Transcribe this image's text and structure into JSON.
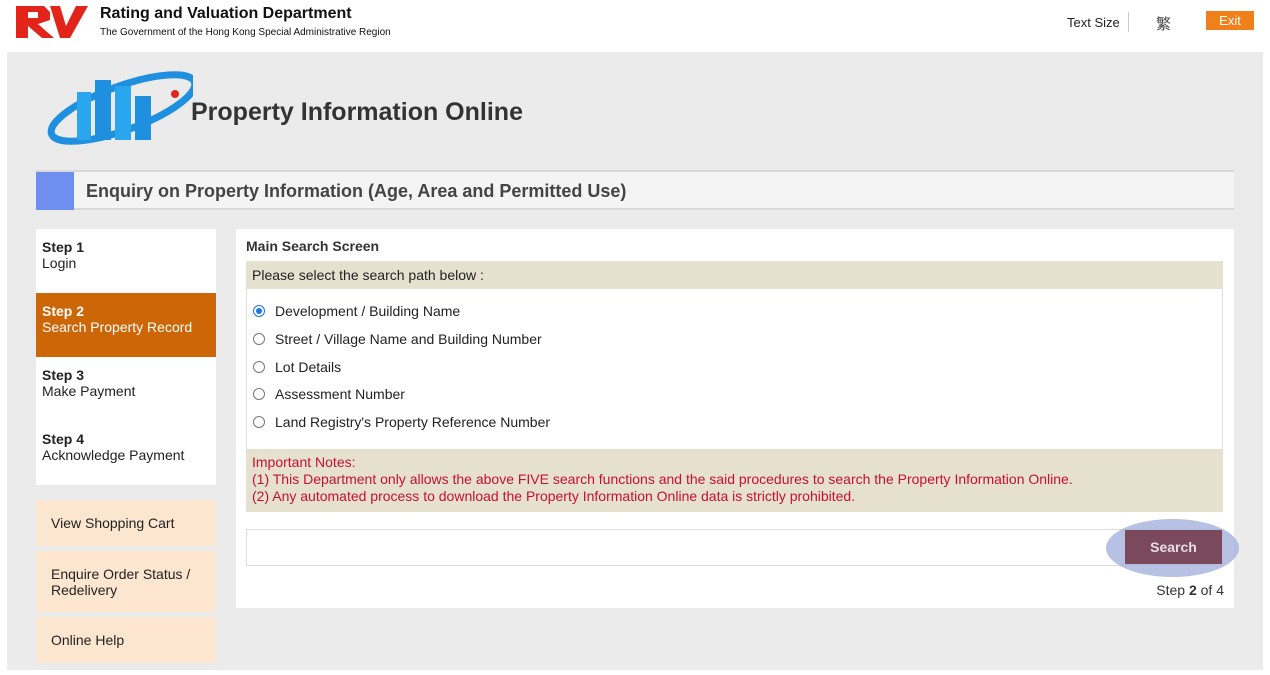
{
  "header": {
    "dept_name": "Rating and Valuation Department",
    "dept_sub": "The Government of the Hong Kong Special Administrative Region",
    "text_size": "Text Size",
    "lang_toggle": "繁",
    "exit": "Exit"
  },
  "app": {
    "title": "Property Information Online"
  },
  "enquiry_title": "Enquiry on Property Information (Age, Area and Permitted Use)",
  "steps": [
    {
      "num": "Step 1",
      "label": "Login",
      "active": false
    },
    {
      "num": "Step 2",
      "label": "Search Property Record",
      "active": true
    },
    {
      "num": "Step 3",
      "label": "Make Payment",
      "active": false
    },
    {
      "num": "Step 4",
      "label": "Acknowledge Payment",
      "active": false
    }
  ],
  "sidebar_buttons": [
    "View Shopping Cart",
    "Enquire Order Status / Redelivery",
    "Online Help"
  ],
  "main": {
    "title": "Main Search Screen",
    "instruction": "Please select the search path below :",
    "options": [
      "Development / Building Name",
      "Street / Village Name and Building Number",
      "Lot Details",
      "Assessment Number",
      "Land Registry's Property Reference Number"
    ],
    "selected_option": "Development / Building Name",
    "notes_title": "Important Notes:",
    "notes": [
      "(1) This Department only allows the above FIVE search functions and the said procedures to search the Property Information Online.",
      "(2) Any automated process to download the Property Information Online data is strictly prohibited."
    ],
    "search_label": "Search",
    "step_prefix": "Step",
    "step_current": "2",
    "step_suffix": "of 4"
  },
  "colors": {
    "exit_button": "#f0801a",
    "active_step": "#cc6606",
    "accent_blue": "#6f8ff0",
    "search_button": "#7a4a5c",
    "notes_text": "#c8102e"
  },
  "icons": {
    "department_logo": "rv-logo",
    "app_logo": "buildings-logo"
  }
}
